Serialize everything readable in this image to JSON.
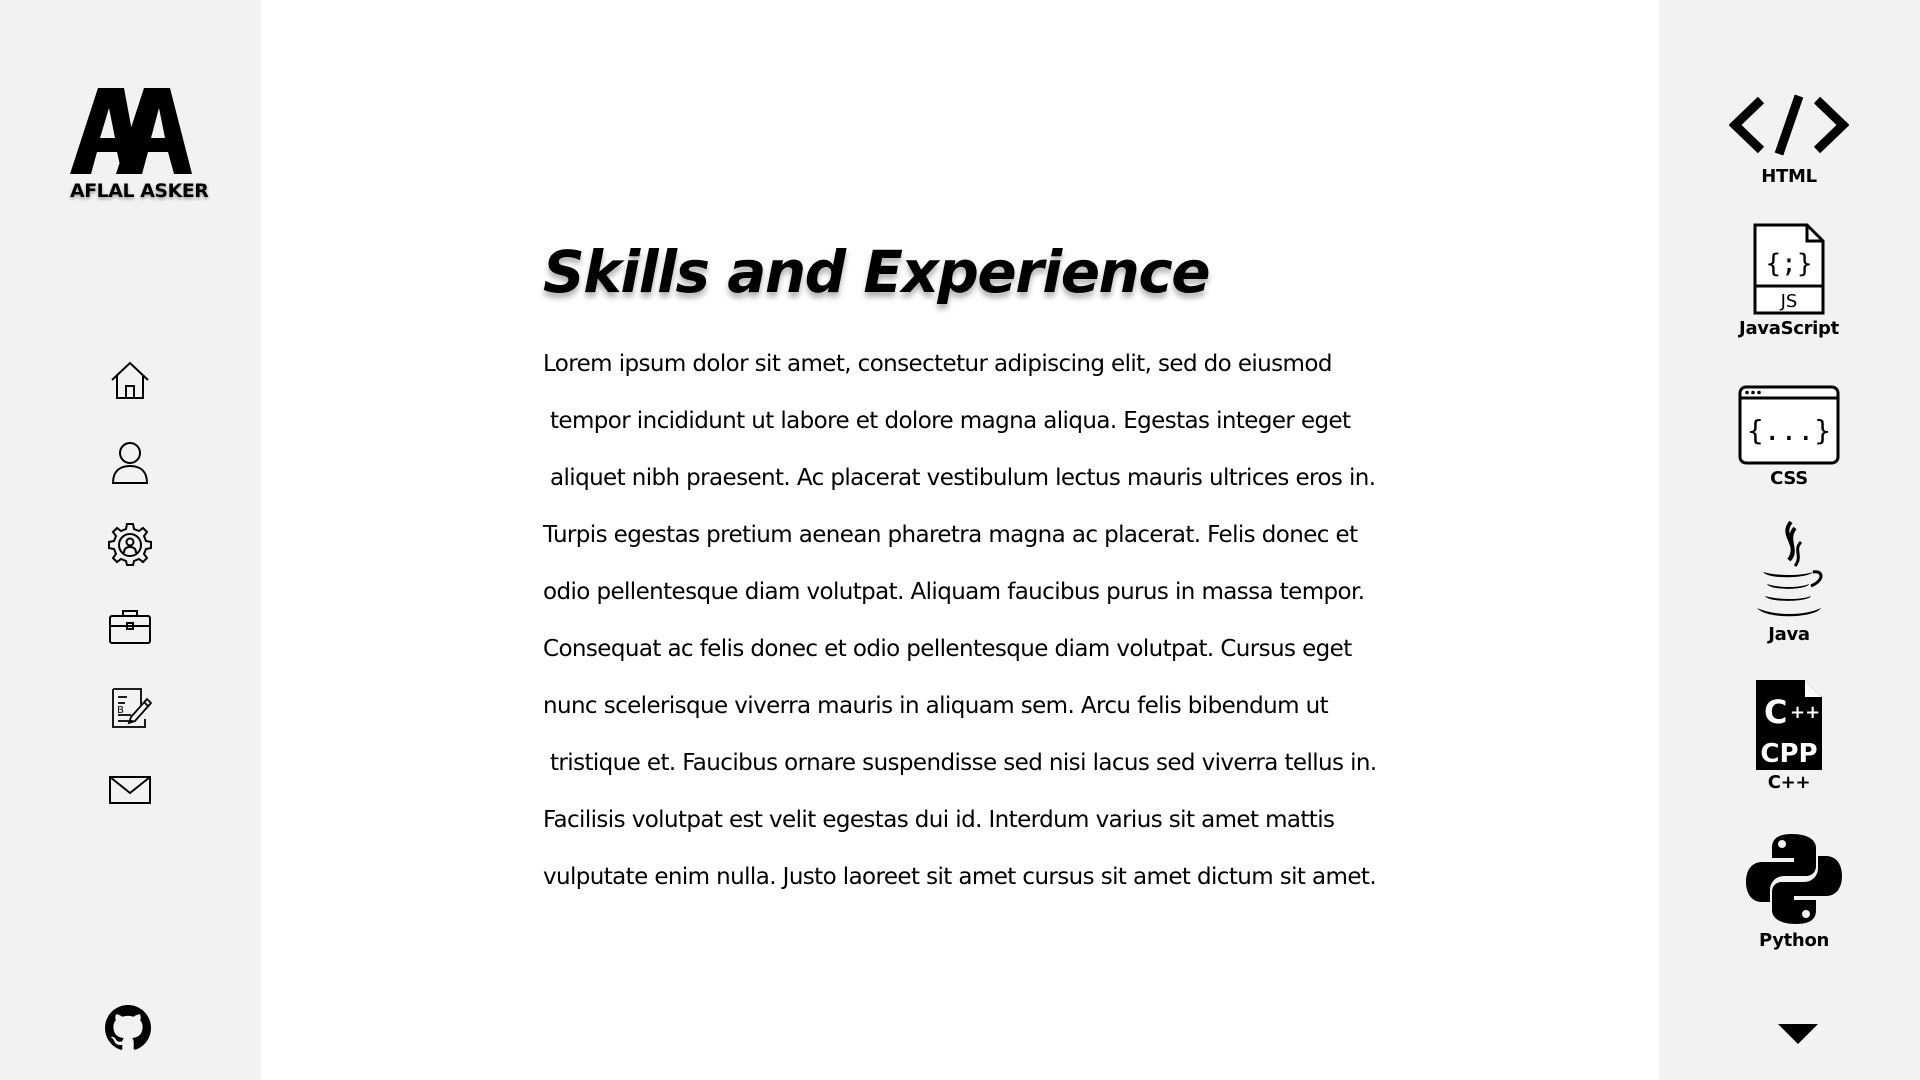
{
  "brand": {
    "monogram": "AA",
    "name": "AFLAL ASKER"
  },
  "nav": [
    {
      "id": "home",
      "icon": "home-icon"
    },
    {
      "id": "about",
      "icon": "user-icon"
    },
    {
      "id": "skills",
      "icon": "gear-person-icon"
    },
    {
      "id": "work",
      "icon": "briefcase-icon"
    },
    {
      "id": "resume",
      "icon": "document-edit-icon"
    },
    {
      "id": "contact",
      "icon": "mail-icon"
    }
  ],
  "github_icon": "github-icon",
  "main": {
    "title": "Skills and Experience",
    "lines": [
      "Lorem ipsum dolor sit amet, consectetur adipiscing elit, sed do eiusmod",
      "tempor incididunt ut labore et dolore magna aliqua. Egestas integer eget",
      "aliquet nibh praesent. Ac placerat vestibulum lectus mauris ultrices eros in.",
      "Turpis egestas pretium aenean pharetra magna ac placerat. Felis donec et",
      "odio pellentesque diam volutpat. Aliquam faucibus purus in massa tempor.",
      "Consequat ac felis donec et odio pellentesque diam volutpat. Cursus eget",
      "nunc scelerisque viverra mauris in aliquam sem. Arcu felis bibendum ut",
      "tristique et. Faucibus ornare suspendisse sed nisi lacus sed viverra tellus in.",
      "Facilisis volutpat est velit egestas dui id. Interdum varius sit amet mattis",
      "vulputate enim nulla. Justo laoreet sit amet cursus sit amet dictum sit amet."
    ]
  },
  "skills": [
    {
      "label": "HTML",
      "icon": "html-code-icon",
      "glyph": "</>"
    },
    {
      "label": "JavaScript",
      "icon": "js-file-icon",
      "glyph": "{;}",
      "sub": "JS"
    },
    {
      "label": "CSS",
      "icon": "css-window-icon",
      "glyph": "{...}"
    },
    {
      "label": "Java",
      "icon": "java-icon"
    },
    {
      "label": "C++",
      "icon": "cpp-file-icon",
      "glyph": "C++",
      "sub": "CPP"
    },
    {
      "label": "Python",
      "icon": "python-icon"
    }
  ],
  "scroll_icon": "caret-down-icon",
  "colors": {
    "sidebar_bg": "#f2f2f2",
    "main_bg": "#ffffff",
    "ink": "#000000"
  }
}
